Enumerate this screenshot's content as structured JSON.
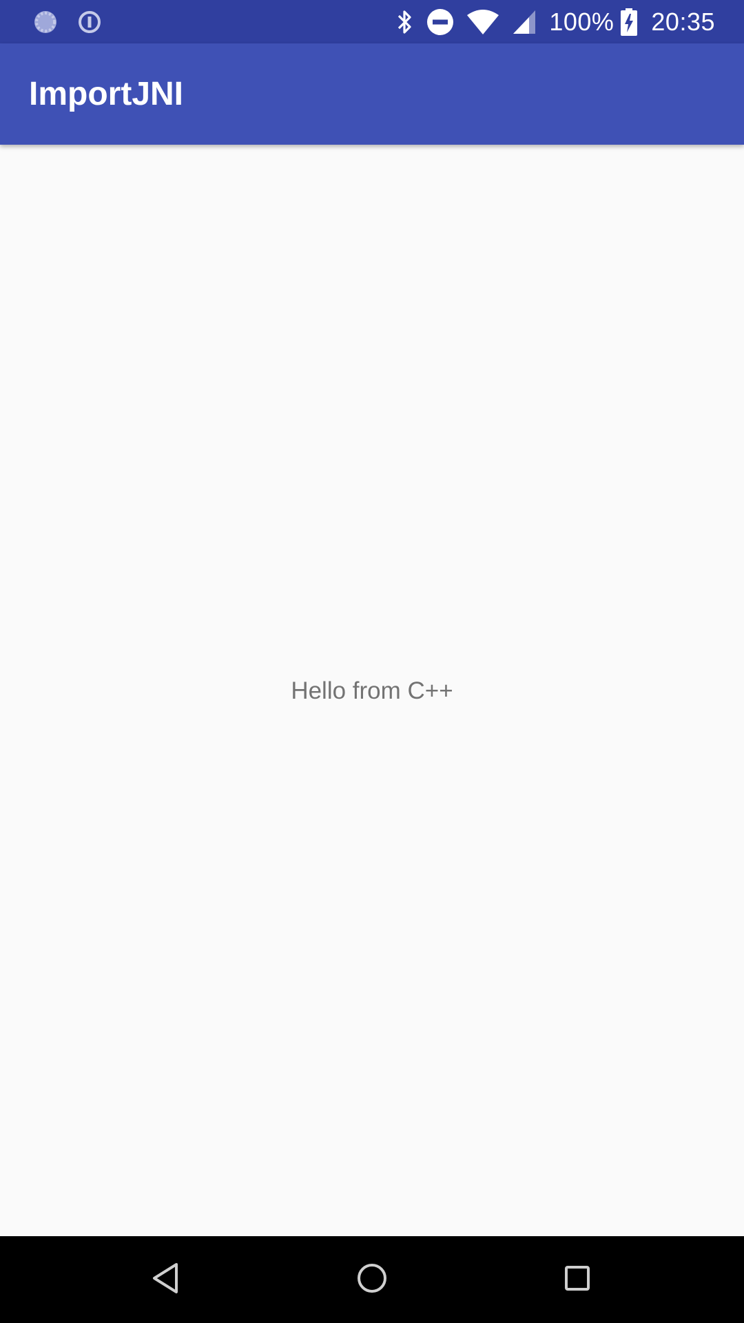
{
  "status_bar": {
    "left_icons": [
      "sync-icon",
      "info-circle-icon"
    ],
    "right_icons": [
      "bluetooth-icon",
      "do-not-disturb-icon",
      "wifi-icon",
      "cell-signal-icon"
    ],
    "battery_percent": "100%",
    "battery_icon": "battery-charging-icon",
    "time": "20:35"
  },
  "app_bar": {
    "title": "ImportJNI"
  },
  "main": {
    "message": "Hello from C++"
  },
  "nav_bar": {
    "buttons": [
      "back-icon",
      "home-icon",
      "recents-icon"
    ]
  },
  "colors": {
    "status_bar": "#303f9f",
    "app_bar": "#3f51b5",
    "background": "#fafafa",
    "text_secondary": "#737373",
    "nav_bar": "#000000"
  }
}
